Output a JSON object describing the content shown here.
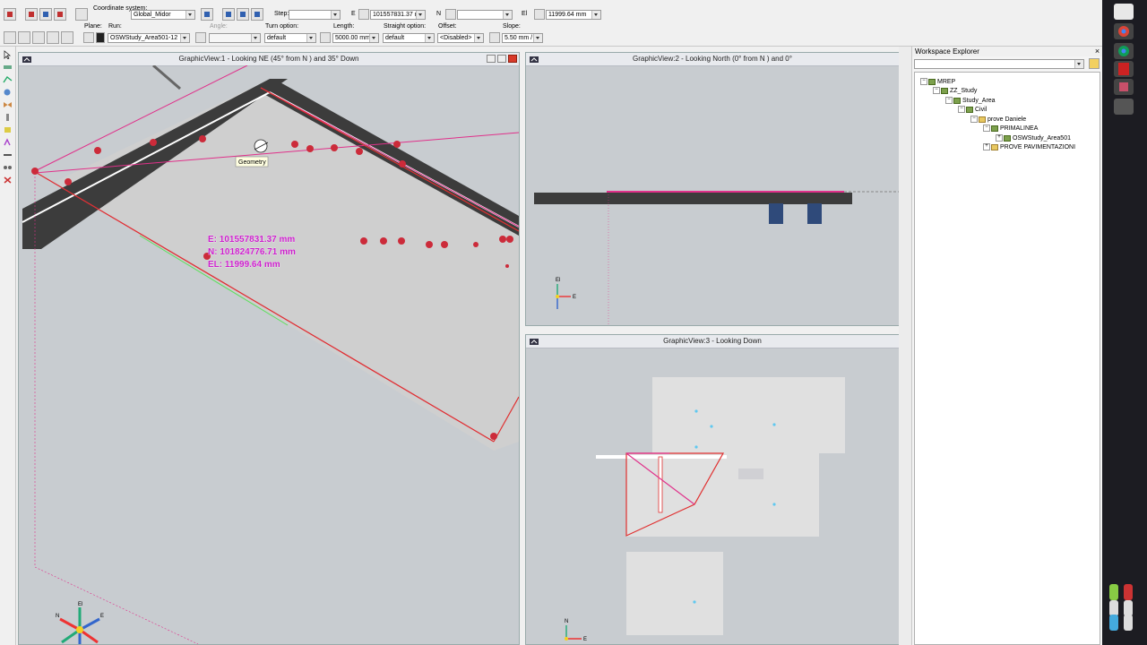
{
  "toolbar": {
    "coord_label": "Coordinate system:",
    "coord_value": "Global_Midor",
    "step_label": "Step:",
    "step_value": "",
    "e_label": "E",
    "e_value": "101557831.37 r",
    "n_label": "N",
    "n_value": "",
    "el_label": "El",
    "el_value": "11999.64 mm",
    "plane_label": "Plane:",
    "run_label": "Run:",
    "run_value": "OSWStudy_Area501-12",
    "angle_label": "Angle:",
    "angle_value": "",
    "turn_label": "Turn option:",
    "turn_value": "default",
    "length_label": "Length:",
    "length_value": "5000.00 mm",
    "straight_label": "Straight option:",
    "straight_value": "default",
    "offset_label": "Offset:",
    "offset_value": "<Disabled>",
    "slope_label": "Slope:",
    "slope_value": "5.50 mm /"
  },
  "views": {
    "v1_title": "GraphicView:1 - Looking NE (45° from N ) and 35° Down",
    "v2_title": "GraphicView:2 - Looking North (0° from N ) and 0°",
    "v3_title": "GraphicView:3 - Looking Down",
    "tooltip": "Geometry",
    "readout_e": "E: 101557831.37 mm",
    "readout_n": "N: 101824776.71 mm",
    "readout_el": "EL: 11999.64 mm",
    "axis_el": "El",
    "axis_e": "E",
    "axis_n": "N"
  },
  "explorer": {
    "title": "Workspace Explorer",
    "tree": [
      {
        "label": "MREP",
        "level": 0
      },
      {
        "label": "ZZ_Study",
        "level": 1
      },
      {
        "label": "Study_Area",
        "level": 2
      },
      {
        "label": "Civil",
        "level": 3
      },
      {
        "label": "prove Daniele",
        "level": 4
      },
      {
        "label": "PRIMALINEA",
        "level": 5
      },
      {
        "label": "OSWStudy_Area501",
        "level": 6
      },
      {
        "label": "PROVE PAVIMENTAZIONI",
        "level": 5
      }
    ]
  },
  "colors": {
    "magenta": "#e0308a",
    "red_line": "#e03030",
    "slab": "#c8c8c8",
    "view_bg": "#c8ccd0",
    "taskbar": "#1c1c22",
    "readout": "#cc20cc"
  }
}
